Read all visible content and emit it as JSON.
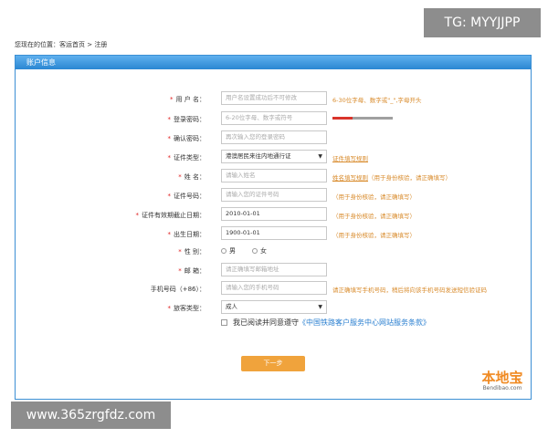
{
  "watermark_top": "TG: MYYJJPP",
  "watermark_bottom": "www.365zrgfdz.com",
  "breadcrumb": {
    "prefix": "您现在的位置：",
    "home": "客运首页",
    "sep": " > ",
    "current": "注册"
  },
  "panel_title": "账户信息",
  "required_mark": "*",
  "fields": {
    "username": {
      "label": "用 户 名：",
      "placeholder": "用户名设置成功后不可修改",
      "hint": "6-30位字母、数字或\"_\",字母开头"
    },
    "password": {
      "label": "登录密码：",
      "placeholder": "6-20位字母、数字或符号"
    },
    "confirm": {
      "label": "确认密码：",
      "placeholder": "再次输入您的登录密码"
    },
    "id_type": {
      "label": "证件类型：",
      "value": "港澳居民来往内地通行证",
      "hint": "证件填写规则"
    },
    "name": {
      "label": "姓  名：",
      "placeholder": "请输入姓名",
      "hint_link": "姓名填写规则",
      "hint": "（用于身份核验，请正确填写）"
    },
    "id_number": {
      "label": "证件号码：",
      "placeholder": "请输入您的证件号码",
      "hint": "（用于身份核验，请正确填写）"
    },
    "expiry": {
      "label": "证件有效期截止日期：",
      "value": "2010-01-01",
      "hint": "（用于身份核验，请正确填写）"
    },
    "birthday": {
      "label": "出生日期：",
      "value": "1900-01-01",
      "hint": "（用于身份核验，请正确填写）"
    },
    "gender": {
      "label": "性  别：",
      "male": "男",
      "female": "女"
    },
    "email": {
      "label": "邮  箱：",
      "placeholder": "请正确填写邮箱地址"
    },
    "phone": {
      "label": "手机号码（+86）：",
      "placeholder": "请输入您的手机号码",
      "hint": "请正确填写手机号码，稍后将向该手机号码发送短信验证码"
    },
    "passenger_type": {
      "label": "旅客类型：",
      "value": "成人"
    }
  },
  "agree": {
    "text": "我已阅读并同意遵守",
    "link": "《中国铁路客户服务中心网站服务条款》"
  },
  "next_button": "下一步",
  "logo": {
    "cn": "本地宝",
    "en": "Bendibao.com"
  },
  "colors": {
    "accent": "#2a86d2",
    "hint": "#d88a2a",
    "button": "#f0a33c",
    "required": "#e02020",
    "strength": [
      "#d9342b",
      "#a0a0a0",
      "#a0a0a0"
    ]
  },
  "icons": {
    "select": "chevron-down-icon"
  }
}
